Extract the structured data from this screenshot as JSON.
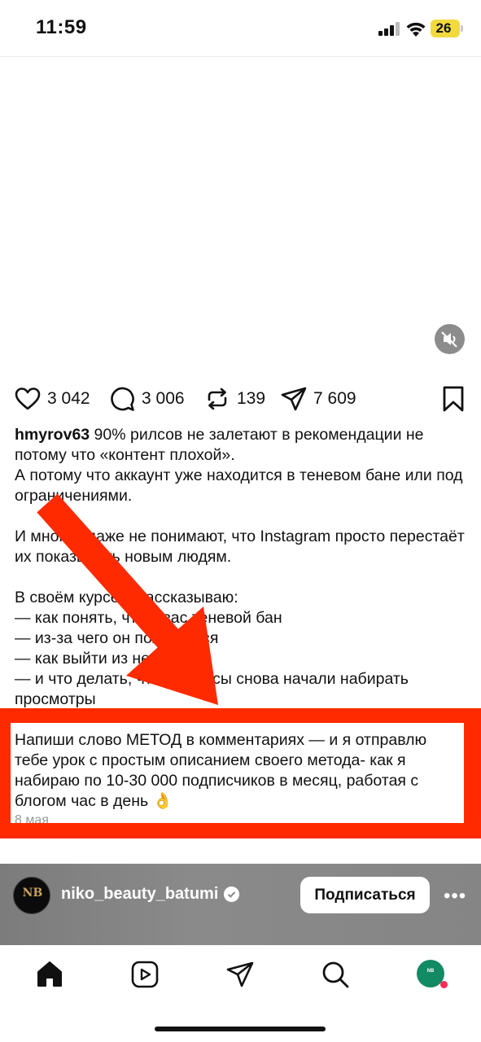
{
  "status_bar": {
    "time": "11:59",
    "battery": "26"
  },
  "actions": {
    "likes": "3 042",
    "comments": "3 006",
    "reposts": "139",
    "shares": "7 609"
  },
  "caption": {
    "username": "hmyrov63",
    "line1": " 90% рилсов не залетают в рекомендации не потому что «контент плохой».",
    "line2": "А потому что аккаунт уже находится в теневом бане или под ограничениями.",
    "line3": "И многие даже не понимают, что Instagram просто перестаёт их показывать новым людям.",
    "line4": "В своём курсе я рассказываю:",
    "bullet1": "— как понять, что у вас теневой бан",
    "bullet2": "— из-за чего он появляется",
    "bullet3": "— как выйти из него",
    "bullet4": "— и что делать, чтобы рилсы снова начали набирать просмотры"
  },
  "highlight": {
    "text": "Напиши слово МЕТОД в комментариях — и я отправлю тебе  урок с простым описанием своего метода- как я набираю по 10-30 000 подписчиков в месяц, работая с блогом час в день 👌",
    "date": "8 мая"
  },
  "banner": {
    "avatar_initials": "NB",
    "account": "niko_beauty_batumi",
    "follow_label": "Подписаться",
    "more_label": "•••"
  },
  "colors": {
    "highlight": "#ff2a00",
    "accent_profile": "#128a63",
    "notification_dot": "#ff2a55"
  }
}
